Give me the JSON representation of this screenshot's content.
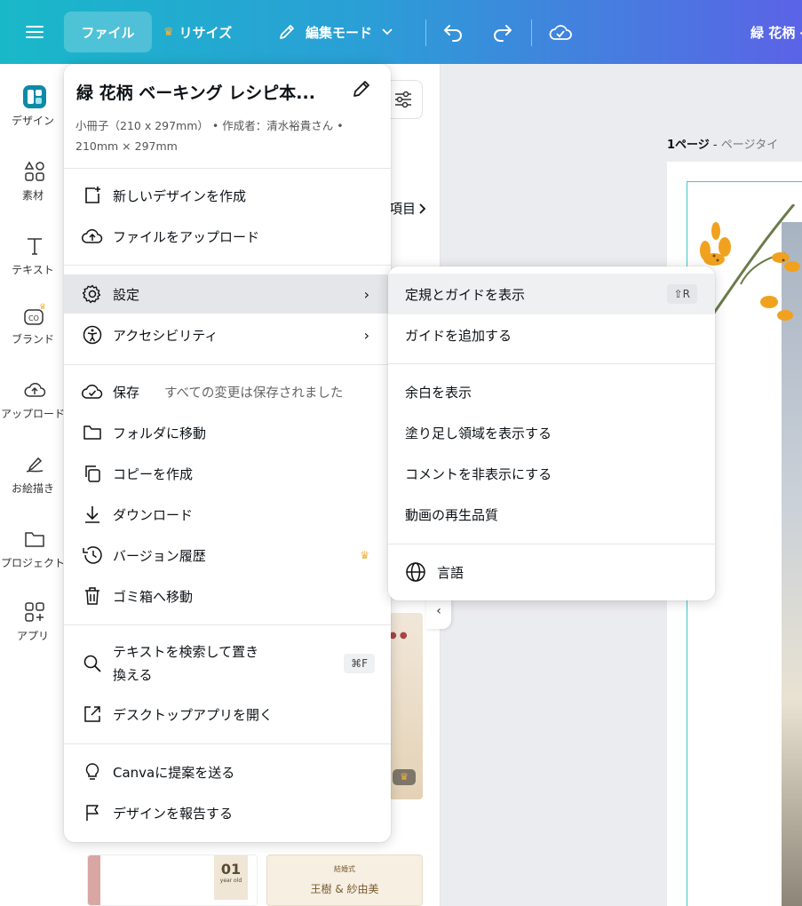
{
  "topbar": {
    "file": "ファイル",
    "resize": "リサイズ",
    "edit_mode": "編集モード",
    "doc_title": "緑 花柄 -"
  },
  "rail": [
    {
      "label": "デザイン",
      "icon": "design-icon"
    },
    {
      "label": "素材",
      "icon": "elements-icon"
    },
    {
      "label": "テキスト",
      "icon": "text-icon"
    },
    {
      "label": "ブランド",
      "icon": "brand-icon"
    },
    {
      "label": "アップロード",
      "icon": "upload-icon"
    },
    {
      "label": "お絵描き",
      "icon": "draw-icon"
    },
    {
      "label": "プロジェクト",
      "icon": "folder-icon"
    },
    {
      "label": "アプリ",
      "icon": "apps-icon"
    }
  ],
  "panel": {
    "link": "項目",
    "thumb_b_number": "01",
    "thumb_b_small": "year old",
    "thumb_c_line1": "結婚式",
    "thumb_c_line2": "王樹 & 紗由美"
  },
  "canvas": {
    "page_number": "1ページ",
    "page_title": "ページタイ"
  },
  "file_menu": {
    "title": "緑 花柄 ベーキング レシピ本...",
    "meta": "小冊子（210 x 297mm） • 作成者：清水裕貴さん • 210mm × 297mm",
    "items": {
      "new_design": "新しいデザインを作成",
      "upload_file": "ファイルをアップロード",
      "settings": "設定",
      "accessibility": "アクセシビリティ",
      "save": "保存",
      "save_status": "すべての変更は保存されました",
      "move_folder": "フォルダに移動",
      "make_copy": "コピーを作成",
      "download": "ダウンロード",
      "version_history": "バージョン履歴",
      "move_trash": "ゴミ箱へ移動",
      "find_replace_1": "テキストを検索して置き",
      "find_replace_2": "換える",
      "find_replace_shortcut": "⌘F",
      "open_desktop": "デスクトップアプリを開く",
      "send_feedback": "Canvaに提案を送る",
      "report_design": "デザインを報告する"
    }
  },
  "settings_submenu": {
    "show_rulers": "定規とガイドを表示",
    "show_rulers_shortcut": "⇧R",
    "add_guides": "ガイドを追加する",
    "show_margins": "余白を表示",
    "show_bleed": "塗り足し領域を表示する",
    "hide_comments": "コメントを非表示にする",
    "video_quality": "動画の再生品質",
    "language": "言語"
  },
  "colors": {
    "gradient_start": "#19b8c9",
    "gradient_end": "#5b63e6",
    "crown": "#f5b33a",
    "guide": "#3cc6cc"
  }
}
